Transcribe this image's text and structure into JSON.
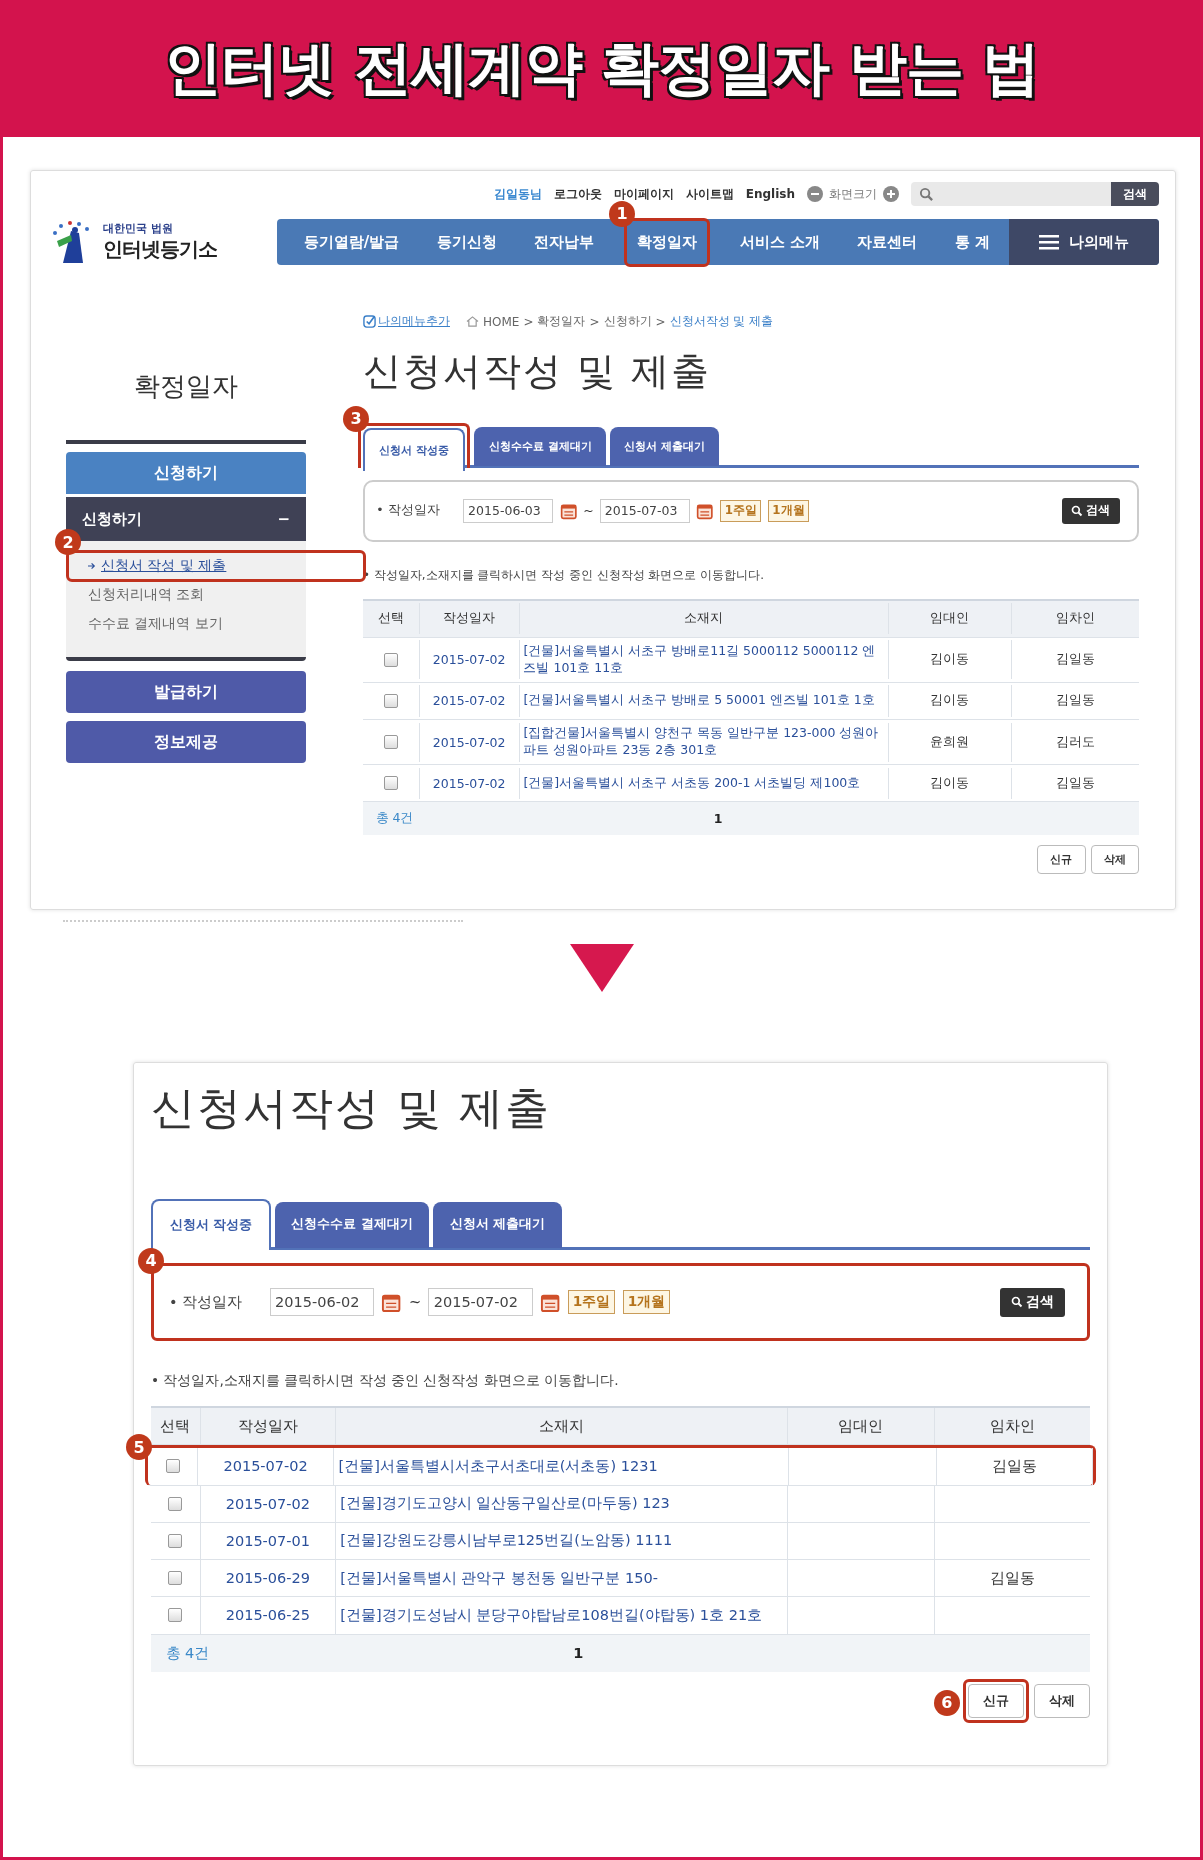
{
  "banner_title": "인터넷 전세계약 확정일자 받는 법",
  "screenshots": [
    {
      "header": {
        "logo_caption": "대한민국 법원",
        "logo_name": "인터넷등기소",
        "utility_links": [
          {
            "label": "김일동님",
            "kind": "user"
          },
          {
            "label": "로그아웃",
            "kind": "link"
          },
          {
            "label": "마이페이지",
            "kind": "link"
          },
          {
            "label": "사이트맵",
            "kind": "link"
          },
          {
            "label": "English",
            "kind": "link"
          }
        ],
        "font_size_label": "화면크기",
        "search_button": "검색",
        "nav": [
          {
            "label": "등기열람/발급"
          },
          {
            "label": "등기신청"
          },
          {
            "label": "전자납부"
          },
          {
            "label": "확정일자",
            "callout": "1"
          },
          {
            "label": "서비스 소개"
          },
          {
            "label": "자료센터"
          },
          {
            "label": "통 계"
          }
        ],
        "my_menu": "나의메뉴"
      },
      "breadcrumb": {
        "add_link": "나의메뉴추가",
        "separator": ">",
        "items": [
          "HOME",
          "확정일자",
          "신청하기",
          "신청서작성 및 제출"
        ]
      },
      "sidebar": {
        "title": "확정일자",
        "menus": [
          {
            "label": "신청하기",
            "expanded": true,
            "children": [
              {
                "label": "신청하기",
                "toggle": "−",
                "children": [
                  {
                    "label": "신청서 작성 및 제출",
                    "selected": true,
                    "callout": "2"
                  },
                  {
                    "label": "신청처리내역 조회",
                    "selected": false
                  },
                  {
                    "label": "수수료 결제내역 보기",
                    "selected": false
                  }
                ]
              }
            ]
          },
          {
            "label": "발급하기",
            "expanded": false
          },
          {
            "label": "정보제공",
            "expanded": false
          }
        ]
      },
      "content": {
        "title": "신청서작성 및 제출",
        "tabs": [
          {
            "label": "신청서 작성중",
            "selected": true,
            "callout": "3"
          },
          {
            "label": "신청수수료 결제대기",
            "selected": false
          },
          {
            "label": "신청서 제출대기",
            "selected": false
          }
        ],
        "search": {
          "label": "• 작성일자",
          "from": "2015-06-03",
          "range_sep": "~",
          "to": "2015-07-03",
          "quick": [
            "1주일",
            "1개월"
          ],
          "button": "검색"
        },
        "note": "• 작성일자,소재지를 클릭하시면 작성 중인 신청작성 화면으로 이동합니다.",
        "table": {
          "columns": [
            "선택",
            "작성일자",
            "소재지",
            "임대인",
            "임차인"
          ],
          "rows": [
            {
              "checked": false,
              "date": "2015-07-02",
              "address": "[건물]서울특별시 서초구 방배로11길 5000112 5000112 엔즈빌 101호 11호",
              "landlord": "김이동",
              "tenant": "김일동"
            },
            {
              "checked": false,
              "date": "2015-07-02",
              "address": "[건물]서울특별시 서초구 방배로 5 50001 엔즈빌 101호 1호",
              "landlord": "김이동",
              "tenant": "김일동"
            },
            {
              "checked": false,
              "date": "2015-07-02",
              "address": "[집합건물]서울특별시 양천구 목동 일반구분 123-000 성원아파트 성원아파트 23동 2층 301호",
              "landlord": "윤희원",
              "tenant": "김러도"
            },
            {
              "checked": false,
              "date": "2015-07-02",
              "address": "[건물]서울특별시 서초구 서초동 200-1 서초빌딩 제100호",
              "landlord": "김이동",
              "tenant": "김일동"
            }
          ],
          "total": "총 4건",
          "page": "1"
        },
        "buttons": [
          {
            "label": "신규"
          },
          {
            "label": "삭제"
          }
        ]
      }
    },
    {
      "content": {
        "title": "신청서작성 및 제출",
        "tabs": [
          {
            "label": "신청서 작성중",
            "selected": true
          },
          {
            "label": "신청수수료 결제대기",
            "selected": false
          },
          {
            "label": "신청서 제출대기",
            "selected": false
          }
        ],
        "search": {
          "label": "• 작성일자",
          "from": "2015-06-02",
          "range_sep": "~",
          "to": "2015-07-02",
          "quick": [
            "1주일",
            "1개월"
          ],
          "button": "검색",
          "callout": "4"
        },
        "note": "• 작성일자,소재지를 클릭하시면 작성 중인 신청작성 화면으로 이동합니다.",
        "table": {
          "columns": [
            "선택",
            "작성일자",
            "소재지",
            "임대인",
            "임차인"
          ],
          "rows": [
            {
              "checked": false,
              "date": "2015-07-02",
              "address": "[건물]서울특별시서초구서초대로(서초동) 1231",
              "tenant": "김일동",
              "callout": "5"
            },
            {
              "checked": false,
              "date": "2015-07-02",
              "address": "[건물]경기도고양시 일산동구일산로(마두동) 123"
            },
            {
              "checked": false,
              "date": "2015-07-01",
              "address": "[건물]강원도강릉시남부로125번길(노암동) 1111"
            },
            {
              "checked": false,
              "date": "2015-06-29",
              "address": "[건물]서울특별시 관악구 봉천동 일반구분 150-",
              "tenant": "김일동"
            },
            {
              "checked": false,
              "date": "2015-06-25",
              "address": "[건물]경기도성남시 분당구야탑남로108번길(야탑동) 1호 21호"
            }
          ],
          "total": "총 4건",
          "page": "1"
        },
        "buttons": [
          {
            "label": "신규",
            "callout": "6"
          },
          {
            "label": "삭제"
          }
        ]
      }
    }
  ]
}
